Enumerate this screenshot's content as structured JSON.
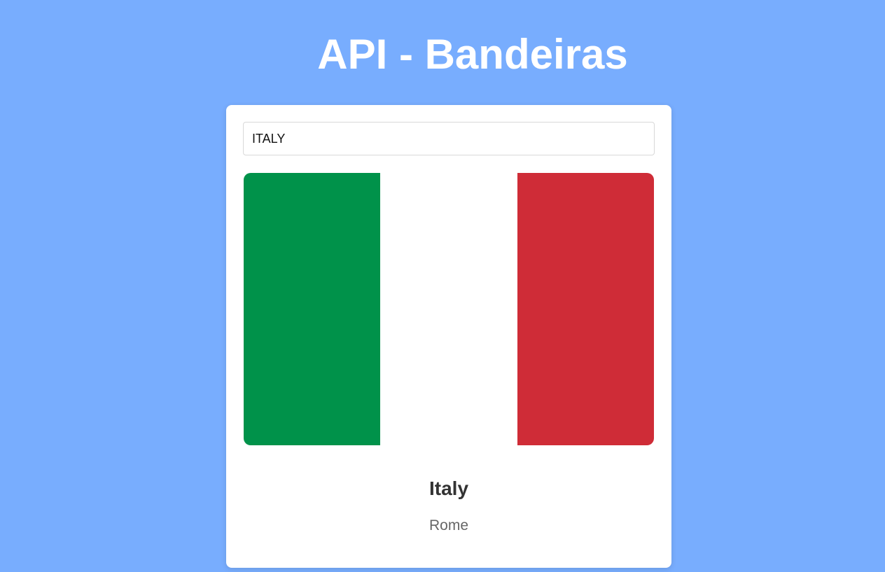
{
  "header": {
    "title": "API - Bandeiras"
  },
  "search": {
    "value": "ITALY",
    "placeholder": ""
  },
  "country": {
    "name": "Italy",
    "capital": "Rome",
    "flag": {
      "bands": [
        "#00924a",
        "#ffffff",
        "#cf2c37"
      ]
    }
  },
  "colors": {
    "background": "#78adfe",
    "card": "#ffffff",
    "title": "#ffffff"
  }
}
